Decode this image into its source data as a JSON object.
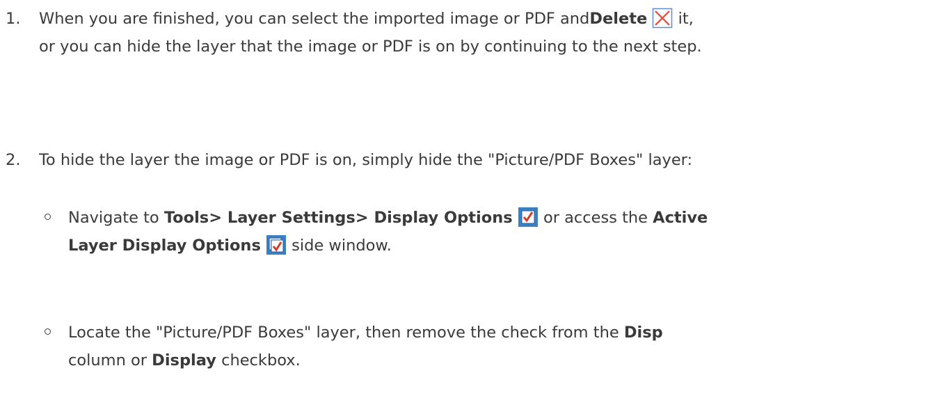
{
  "step1": {
    "number": "1.",
    "text_before": "When you are finished, you can select the imported image or PDF and",
    "bold_delete": "Delete",
    "text_after_icon": " it,",
    "line2": "or you can hide the layer that the image or PDF is on by continuing to the next step.",
    "delete_icon": "delete-x-icon"
  },
  "step2": {
    "number": "2.",
    "text": "To hide the layer the image or PDF is on, simply hide the \"Picture/PDF Boxes\" layer:"
  },
  "sub1": {
    "text_navigate": "Navigate to ",
    "bold_path": "Tools> Layer Settings> Display Options",
    "text_or": " or access the ",
    "bold_active": "Active",
    "bold_layer_display": "Layer Display Options",
    "text_side": " side window.",
    "display_options_icon": "display-options-checkbox-icon",
    "active_layer_icon": "active-layer-display-options-icon"
  },
  "sub2": {
    "text_locate": "Locate the \"Picture/PDF Boxes\" layer, then remove the check from the ",
    "bold_disp": "Disp",
    "text_column": "column or ",
    "bold_display": "Display",
    "text_checkbox": " checkbox."
  },
  "colors": {
    "text": "#3a3a3a",
    "icon_blue": "#3b7fc4",
    "check_red": "#d23b2a"
  }
}
